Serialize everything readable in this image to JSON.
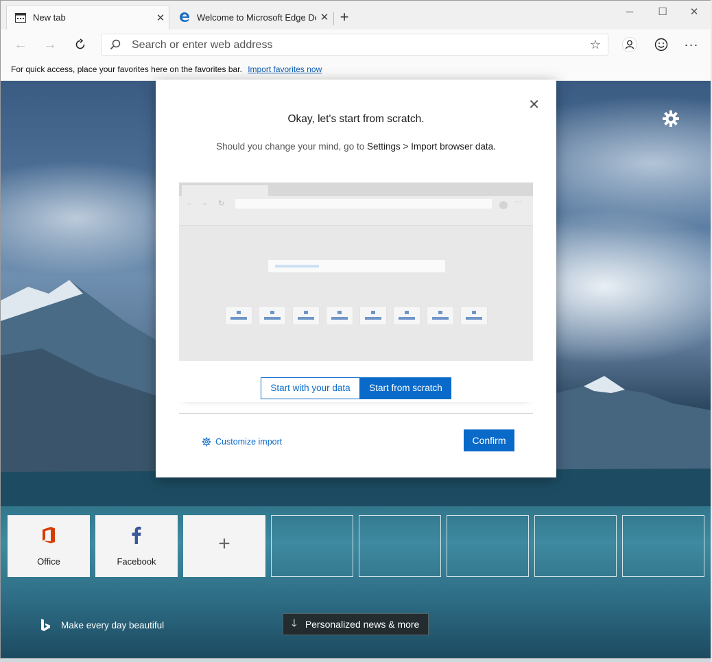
{
  "tabs": [
    {
      "label": "New tab",
      "icon": "new-tab-page-icon"
    },
    {
      "label": "Welcome to Microsoft Edge Dev",
      "icon": "edge-logo-icon"
    }
  ],
  "window_controls": {
    "minimize": "─",
    "maximize": "☐",
    "close": "✕"
  },
  "address_bar": {
    "placeholder": "Search or enter web address",
    "value": ""
  },
  "favorites_bar": {
    "message": "For quick access, place your favorites here on the favorites bar.",
    "link": "Import favorites now"
  },
  "dialog": {
    "title": "Okay, let's start from scratch.",
    "subtitle_prefix": "Should you change your mind, go to ",
    "subtitle_path": "Settings > Import browser data.",
    "option_with_data": "Start with your data",
    "option_scratch": "Start from scratch",
    "selected_option": "Start from scratch",
    "customize_link": "Customize import",
    "confirm": "Confirm"
  },
  "quick_links": [
    {
      "label": "Office",
      "icon": "office-logo-icon"
    },
    {
      "label": "Facebook",
      "icon": "facebook-logo-icon"
    }
  ],
  "add_tile": "+",
  "footer": {
    "bing_text": "Make every day beautiful",
    "news_button": "Personalized news & more"
  },
  "colors": {
    "accent": "#0a6ac9",
    "office": "#d83b01",
    "facebook": "#3b5998"
  }
}
